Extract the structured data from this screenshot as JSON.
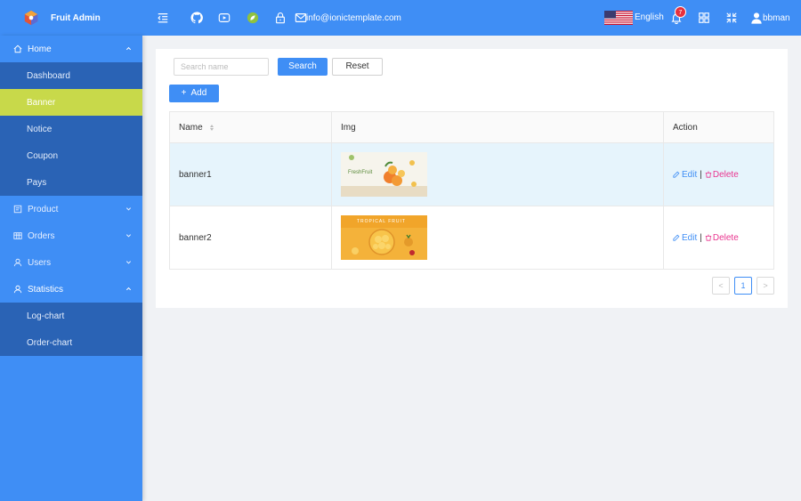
{
  "app": {
    "title": "Fruit Admin"
  },
  "header": {
    "email": "info@ionictemplate.com",
    "language": "English",
    "notification_count": "7",
    "username": "bbman",
    "icons": [
      "menu-fold-icon",
      "github-icon",
      "youtube-icon",
      "leaf-icon",
      "lock-icon",
      "mail-icon",
      "bell-icon",
      "grid-icon",
      "fullscreen-icon",
      "user-icon"
    ]
  },
  "sidebar": {
    "home": {
      "label": "Home",
      "items": [
        {
          "label": "Dashboard"
        },
        {
          "label": "Banner"
        },
        {
          "label": "Notice"
        },
        {
          "label": "Coupon"
        },
        {
          "label": "Pays"
        }
      ]
    },
    "product": {
      "label": "Product"
    },
    "orders": {
      "label": "Orders"
    },
    "users": {
      "label": "Users"
    },
    "statistics": {
      "label": "Statistics",
      "items": [
        {
          "label": "Log-chart"
        },
        {
          "label": "Order-chart"
        }
      ]
    }
  },
  "toolbar": {
    "search_placeholder": "Search name",
    "search_label": "Search",
    "reset_label": "Reset",
    "add_label": "Add"
  },
  "table": {
    "columns": [
      "Name",
      "Img",
      "Action"
    ],
    "rows": [
      {
        "name": "banner1",
        "img_text": "FreshFruit"
      },
      {
        "name": "banner2",
        "img_text": "TROPICAL FRUIT"
      }
    ],
    "edit_label": "Edit",
    "delete_label": "Delete",
    "separator": "|"
  },
  "pagination": {
    "current": "1",
    "prev": "<",
    "next": ">"
  },
  "colors": {
    "primary": "#3f8ef5",
    "submenu": "#2a63b5",
    "active": "#c8d94a",
    "delete": "#e9358f"
  }
}
